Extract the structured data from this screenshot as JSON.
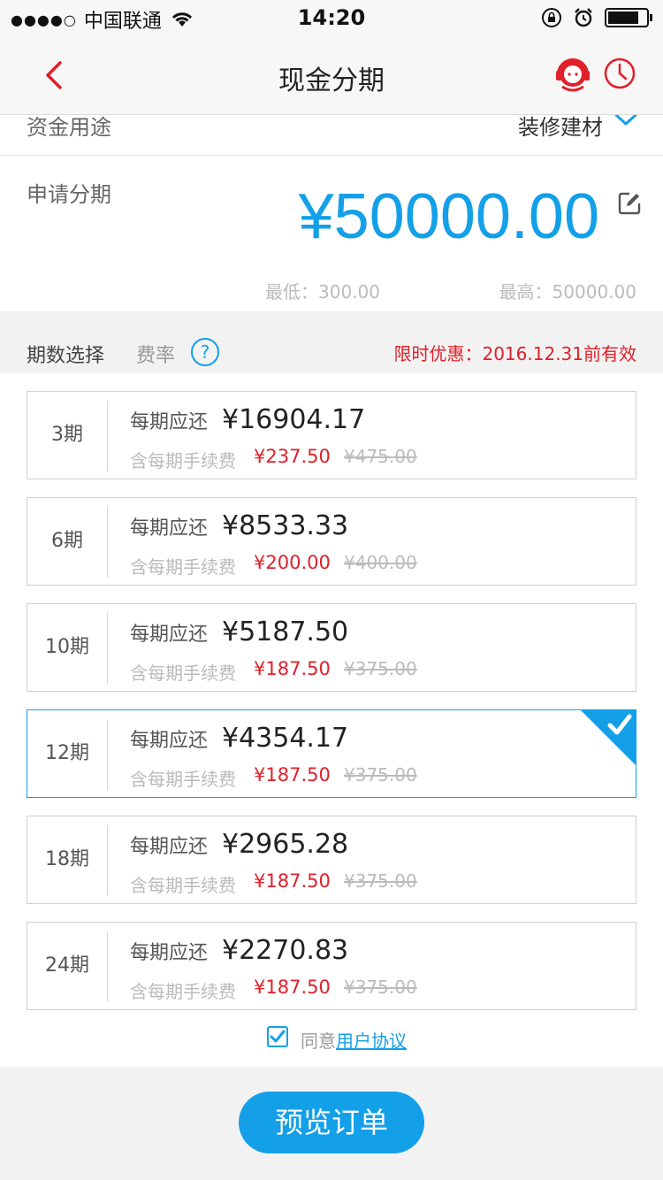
{
  "status": {
    "signal": "●●●●○",
    "carrier": "中国联通",
    "time": "14:20"
  },
  "nav": {
    "title": "现金分期"
  },
  "usage": {
    "label": "资金用途",
    "value": "装修建材"
  },
  "amount": {
    "label": "申请分期",
    "value": "¥50000.00",
    "min": "最低：300.00",
    "max": "最高：50000.00"
  },
  "period_header": {
    "label": "期数选择",
    "rate": "费率",
    "help": "?",
    "promo": "限时优惠：2016.12.31前有效"
  },
  "plans": [
    {
      "term": "3期",
      "pay_label": "每期应还",
      "pay": "¥16904.17",
      "fee_label": "含每期手续费",
      "fee": "¥237.50",
      "fee_old": "¥475.00",
      "selected": false
    },
    {
      "term": "6期",
      "pay_label": "每期应还",
      "pay": "¥8533.33",
      "fee_label": "含每期手续费",
      "fee": "¥200.00",
      "fee_old": "¥400.00",
      "selected": false
    },
    {
      "term": "10期",
      "pay_label": "每期应还",
      "pay": "¥5187.50",
      "fee_label": "含每期手续费",
      "fee": "¥187.50",
      "fee_old": "¥375.00",
      "selected": false
    },
    {
      "term": "12期",
      "pay_label": "每期应还",
      "pay": "¥4354.17",
      "fee_label": "含每期手续费",
      "fee": "¥187.50",
      "fee_old": "¥375.00",
      "selected": true
    },
    {
      "term": "18期",
      "pay_label": "每期应还",
      "pay": "¥2965.28",
      "fee_label": "含每期手续费",
      "fee": "¥187.50",
      "fee_old": "¥375.00",
      "selected": false
    },
    {
      "term": "24期",
      "pay_label": "每期应还",
      "pay": "¥2270.83",
      "fee_label": "含每期手续费",
      "fee": "¥187.50",
      "fee_old": "¥375.00",
      "selected": false
    }
  ],
  "agree": {
    "text": "同意",
    "link": "用户协议",
    "checked": true
  },
  "footer": {
    "button": "预览订单"
  },
  "colors": {
    "accent": "#14a0e8",
    "red": "#e0202a"
  },
  "icons": [
    "back-icon",
    "customer-service-icon",
    "clock-icon",
    "chevron-down-icon",
    "edit-icon",
    "help-icon",
    "check-icon",
    "wifi-icon",
    "lock-rotation-icon",
    "alarm-icon",
    "battery-icon"
  ]
}
